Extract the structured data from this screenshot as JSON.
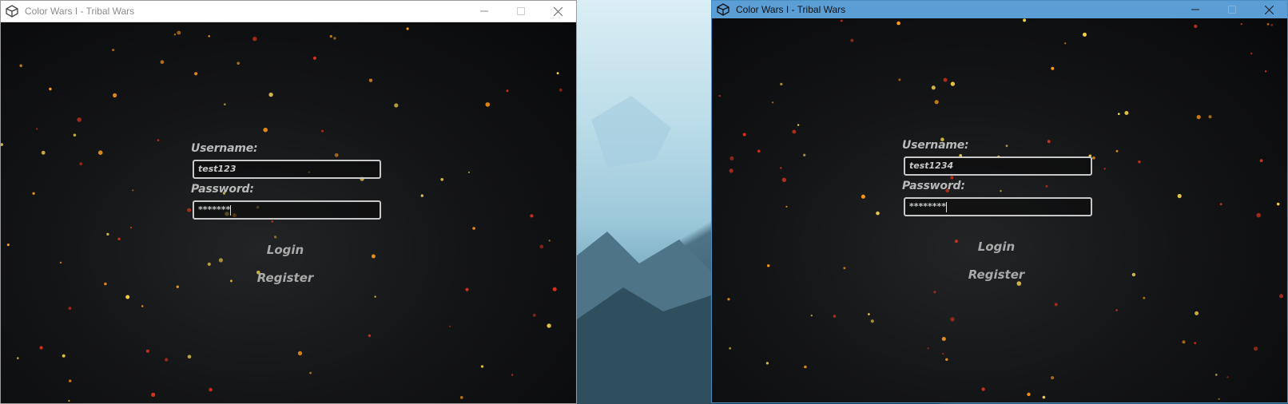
{
  "windows": [
    {
      "id": "left",
      "title": "Color Wars I - Tribal Wars",
      "login_form": {
        "username_label": "Username:",
        "username_value": "test123",
        "password_label": "Password:",
        "password_value": "*******",
        "login_label": "Login",
        "register_label": "Register"
      }
    },
    {
      "id": "right",
      "title": "Color Wars I - Tribal Wars",
      "login_form": {
        "username_label": "Username:",
        "username_value": "test1234",
        "password_label": "Password:",
        "password_value": "********",
        "login_label": "Login",
        "register_label": "Register"
      }
    }
  ],
  "icons": {
    "app": "unity-icon",
    "minimize": "minimize-icon",
    "maximize": "maximize-icon",
    "close": "close-icon"
  },
  "colors": {
    "left_titlebar": "#ffffff",
    "right_titlebar": "#5b9ed6",
    "ember_orange": "#ff9a1a",
    "ember_red": "#d8321a",
    "ember_yellow": "#ffd84a",
    "label_gray": "#b9b9b9"
  }
}
